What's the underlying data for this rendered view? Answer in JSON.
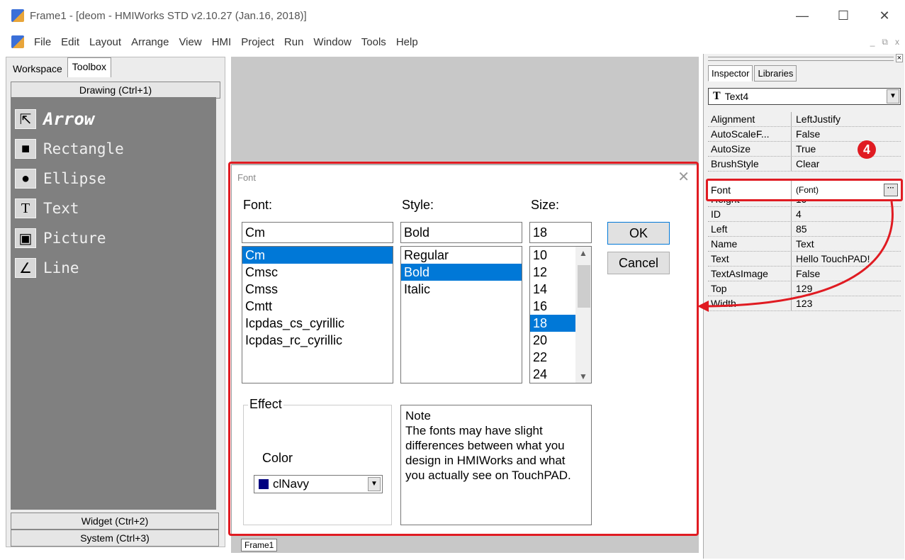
{
  "window": {
    "title": "Frame1 - [deom - HMIWorks STD v2.10.27 (Jan.16, 2018)]",
    "minimize": "—",
    "maximize": "☐",
    "close": "✕"
  },
  "menu": {
    "items": [
      "File",
      "Edit",
      "Layout",
      "Arrange",
      "View",
      "HMI",
      "Project",
      "Run",
      "Window",
      "Tools",
      "Help"
    ],
    "mdi_min": "_",
    "mdi_restore": "⧉",
    "mdi_close": "x"
  },
  "left": {
    "tabs": [
      "Workspace",
      "Toolbox"
    ],
    "drawing_header": "Drawing (Ctrl+1)",
    "tools": [
      {
        "label": "Arrow",
        "glyph": "⇱"
      },
      {
        "label": "Rectangle",
        "glyph": "■"
      },
      {
        "label": "Ellipse",
        "glyph": "●"
      },
      {
        "label": "Text",
        "glyph": "T"
      },
      {
        "label": "Picture",
        "glyph": "▣"
      },
      {
        "label": "Line",
        "glyph": "∠"
      }
    ],
    "widget_header": "Widget (Ctrl+2)",
    "system_header": "System (Ctrl+3)"
  },
  "frame_tab": "Frame1",
  "dialog": {
    "title": "Font",
    "close": "✕",
    "font_label": "Font:",
    "style_label": "Style:",
    "size_label": "Size:",
    "font_value": "Cm",
    "style_value": "Bold",
    "size_value": "18",
    "fonts": [
      "Cm",
      "Cmsc",
      "Cmss",
      "Cmtt",
      "Icpdas_cs_cyrillic",
      "Icpdas_rc_cyrillic"
    ],
    "styles": [
      "Regular",
      "Bold",
      "Italic"
    ],
    "sizes": [
      "10",
      "12",
      "14",
      "16",
      "18",
      "20",
      "22",
      "24"
    ],
    "ok": "OK",
    "cancel": "Cancel",
    "effect_label": "Effect",
    "color_label": "Color",
    "color_value": "clNavy",
    "note_title": "Note",
    "note_body": "The fonts may have slight differences between what you design in HMIWorks and what you actually see on TouchPAD."
  },
  "inspector": {
    "tabs": [
      "Inspector",
      "Libraries"
    ],
    "object": "Text4",
    "rows_top": [
      {
        "name": "Alignment",
        "value": "LeftJustify"
      },
      {
        "name": "AutoScaleF...",
        "value": "False"
      },
      {
        "name": "AutoSize",
        "value": "True"
      },
      {
        "name": "BrushStyle",
        "value": "Clear"
      }
    ],
    "font_row": {
      "name": "Font",
      "value": "(Font)"
    },
    "rows_bottom": [
      {
        "name": "Height",
        "value": "19"
      },
      {
        "name": "ID",
        "value": "4"
      },
      {
        "name": "Left",
        "value": "85"
      },
      {
        "name": "Name",
        "value": "Text"
      },
      {
        "name": "Text",
        "value": "Hello TouchPAD!"
      },
      {
        "name": "TextAsImage",
        "value": "False"
      },
      {
        "name": "Top",
        "value": "129"
      },
      {
        "name": "Width",
        "value": "123"
      }
    ],
    "step_badge": "4"
  }
}
